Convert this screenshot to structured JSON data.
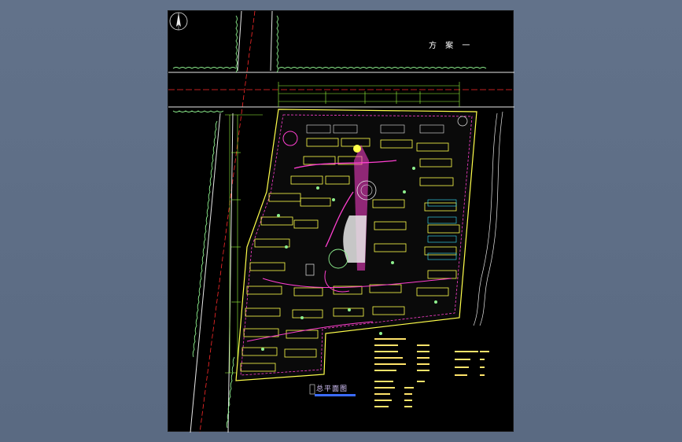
{
  "drawing": {
    "scheme_label": "方 案 一",
    "plan_title": "总平面图"
  },
  "colors": {
    "canvas_bg": "#5e6e86",
    "sheet_bg": "#000000",
    "tree_green": "#8ef08e",
    "road_white": "#e8e8e8",
    "axis_red": "#ff2a2a",
    "building_magenta": "#ff3fd0",
    "boundary_yellow": "#ffff4a",
    "dimension_green": "#9cff3c",
    "text_yellow": "#ffe36a",
    "water_cyan": "#3be7ff"
  },
  "icons": {
    "north_arrow": "north-arrow-icon"
  }
}
